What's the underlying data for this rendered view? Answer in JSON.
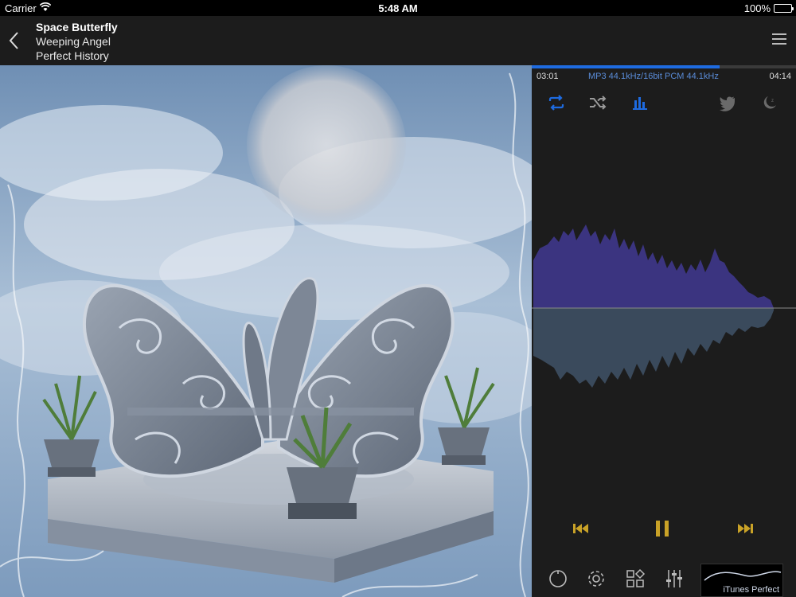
{
  "status_bar": {
    "carrier": "Carrier",
    "time": "5:48 AM",
    "battery": "100%"
  },
  "header": {
    "song_title": "Space Butterfly",
    "artist": "Weeping Angel",
    "album": "Perfect History"
  },
  "playback": {
    "elapsed": "03:01",
    "total": "04:14",
    "format": "MP3  44.1kHz/16bit  PCM 44.1kHz",
    "progress_fraction": 0.71
  },
  "controls": {
    "repeat_icon": "repeat-icon",
    "shuffle_icon": "shuffle-icon",
    "spectrum_icon": "spectrum-icon",
    "twitter_icon": "twitter-icon",
    "sleep_icon": "sleep-timer-icon",
    "prev_icon": "previous-icon",
    "pause_icon": "pause-icon",
    "next_icon": "next-icon"
  },
  "bottom_bar": {
    "power_icon": "power-icon",
    "settings_icon": "gear-icon",
    "grid_icon": "grid-icon",
    "eq_icon": "equalizer-sliders-icon",
    "eq_preset": "iTunes Perfect"
  },
  "colors": {
    "accent_blue": "#1e6be0",
    "transport_gold": "#c9a227",
    "wave_top": "#3b3480",
    "wave_bottom": "#3a4a5c"
  }
}
